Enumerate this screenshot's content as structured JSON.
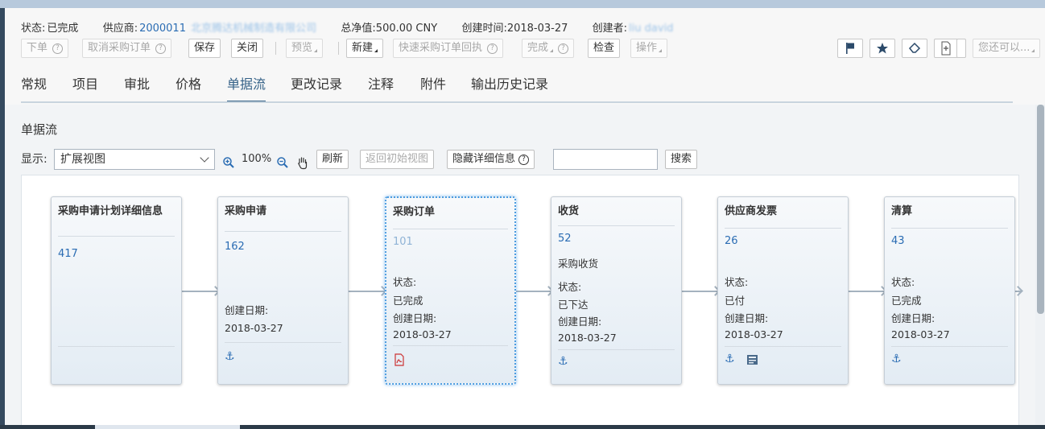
{
  "summary": {
    "status_label": "状态:",
    "status_value": "已完成",
    "supplier_label": "供应商:",
    "supplier_id": "2000011",
    "supplier_name": "北京腾达机械制造有限公司",
    "net_value": "总净值:500.00 CNY",
    "created_time": "创建时间:2018-03-27",
    "creator_label": "创建者:",
    "creator_name": "liu david"
  },
  "toolbar": {
    "order": "下单",
    "cancel_po": "取消采购订单",
    "save": "保存",
    "close": "关闭",
    "preview": "预览",
    "new": "新建",
    "quick_ack": "快速采购订单回执",
    "complete": "完成",
    "check": "检查",
    "operation": "操作",
    "you_can": "您还可以..."
  },
  "tabs": [
    "常规",
    "项目",
    "审批",
    "价格",
    "单据流",
    "更改记录",
    "注释",
    "附件",
    "输出历史记录"
  ],
  "docflow": {
    "title": "单据流",
    "display_label": "显示:",
    "view_option": "扩展视图",
    "zoom": "100%",
    "refresh": "刷新",
    "back_to_initial": "返回初始视图",
    "hide_details": "隐藏详细信息",
    "search_value": "",
    "search": "搜索"
  },
  "cards": [
    {
      "title": "采购申请计划详细信息",
      "number": "417"
    },
    {
      "title": "采购申请",
      "number": "162",
      "date_label": "创建日期:",
      "date": "2018-03-27",
      "icon": "anchor-icon"
    },
    {
      "title": "采购订单",
      "number": "101",
      "status_label": "状态:",
      "status": "已完成",
      "date_label": "创建日期:",
      "date": "2018-03-27",
      "icon": "pdf-icon"
    },
    {
      "title": "收货",
      "number": "52",
      "type": "采购收货",
      "status_label": "状态:",
      "status": "已下达",
      "date_label": "创建日期:",
      "date": "2018-03-27",
      "icon": "anchor-icon"
    },
    {
      "title": "供应商发票",
      "number": "26",
      "status_label": "状态:",
      "status": "已付",
      "date_label": "创建日期:",
      "date": "2018-03-27",
      "icon": "anchor-icon",
      "icon2": "document-icon"
    },
    {
      "title": "清算",
      "number": "43",
      "status_label": "状态:",
      "status": "已完成",
      "date_label": "创建日期:",
      "date": "2018-03-27",
      "icon": "anchor-icon"
    }
  ]
}
